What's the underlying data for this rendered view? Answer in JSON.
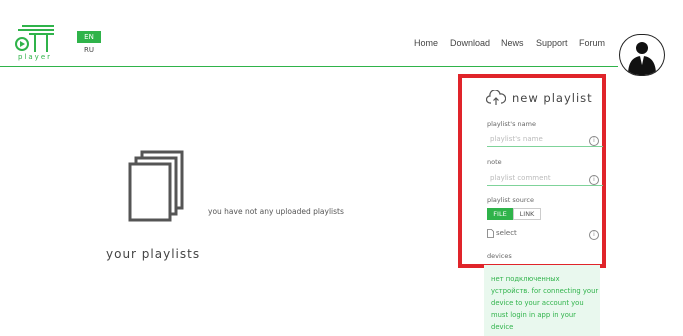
{
  "brand": {
    "logo_text": "player"
  },
  "languages": {
    "active": "EN",
    "other": "RU"
  },
  "nav": [
    "Home",
    "Download",
    "News",
    "Support",
    "Forum"
  ],
  "main": {
    "empty_message": "you have not any uploaded playlists",
    "section_title": "your playlists"
  },
  "panel": {
    "title": "new playlist",
    "name_label": "playlist's name",
    "name_placeholder": "playlist's name",
    "note_label": "note",
    "note_placeholder": "playlist comment",
    "source_label": "playlist source",
    "source_options": [
      "FILE",
      "LINK"
    ],
    "select_label": "select",
    "devices_label": "devices"
  },
  "devices_message": "нет подключенных устройств. for connecting your device to your account you must login in app in your device",
  "colors": {
    "accent": "#2fb34a",
    "highlight": "#e0242a",
    "devices_bg": "#e9f8ee"
  },
  "icons": [
    "ott-player-logo-icon",
    "user-avatar-icon",
    "documents-icon",
    "cloud-upload-icon",
    "info-icon",
    "file-icon"
  ]
}
